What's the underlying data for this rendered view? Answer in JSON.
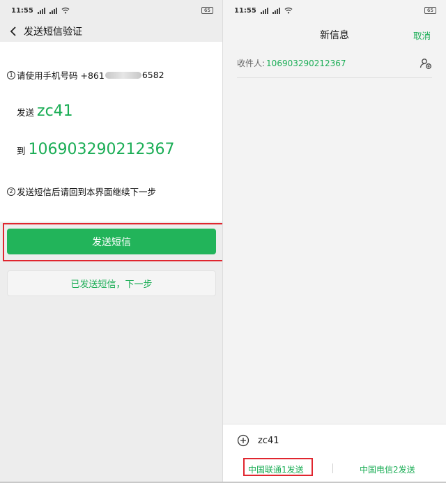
{
  "left": {
    "status": {
      "time": "11:55",
      "battery": "65"
    },
    "header": {
      "title": "发送短信验证"
    },
    "step1": {
      "num": "1",
      "text_a": "请使用手机号码 +861",
      "text_b": "6582"
    },
    "send": {
      "label": "发送",
      "code": "zc41"
    },
    "to": {
      "label": "到",
      "number": "106903290212367"
    },
    "step2": {
      "num": "2",
      "text": "发送短信后请回到本界面继续下一步"
    },
    "primary_button": "发送短信",
    "secondary_button": "已发送短信，下一步"
  },
  "right": {
    "status": {
      "time": "11:55",
      "battery": "65"
    },
    "nav": {
      "title": "新信息",
      "cancel": "取消"
    },
    "recipient": {
      "label": "收件人:",
      "number": "106903290212367"
    },
    "compose": {
      "text": "zc41"
    },
    "send_sim1": "中国联通1发送",
    "send_sim2": "中国电信2发送"
  },
  "colors": {
    "accent": "#1aad55",
    "button": "#22b45a",
    "highlight": "#e0262f"
  }
}
